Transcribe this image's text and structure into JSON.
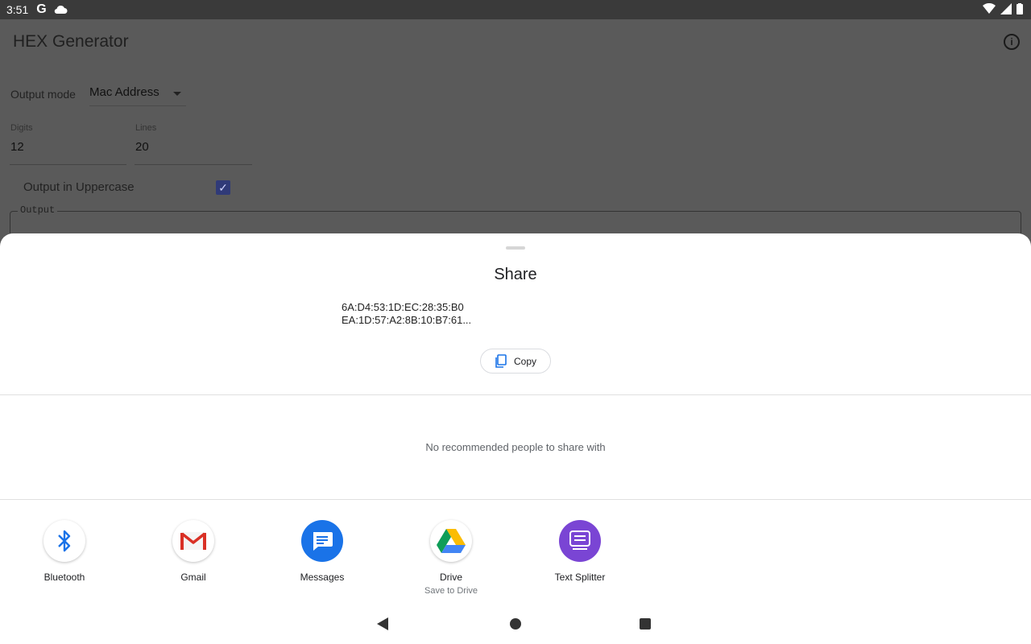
{
  "status": {
    "time": "3:51",
    "google_glyph": "G"
  },
  "app": {
    "title": "HEX Generator",
    "output_mode_label": "Output mode",
    "output_mode_value": "Mac Address",
    "digits_label": "Digits",
    "digits_value": "12",
    "lines_label": "Lines",
    "lines_value": "20",
    "uppercase_label": "Output in Uppercase",
    "output_label": "Output"
  },
  "share": {
    "title": "Share",
    "preview_line1": "6A:D4:53:1D:EC:28:35:B0",
    "preview_line2": "EA:1D:57:A2:8B:10:B7:61...",
    "copy_label": "Copy",
    "no_people": "No recommended people to share with",
    "apps": [
      {
        "name": "Bluetooth",
        "sub": ""
      },
      {
        "name": "Gmail",
        "sub": ""
      },
      {
        "name": "Messages",
        "sub": ""
      },
      {
        "name": "Drive",
        "sub": "Save to Drive"
      },
      {
        "name": "Text Splitter",
        "sub": ""
      }
    ]
  },
  "colors": {
    "messages_blue": "#1a73e8",
    "splitter_purple": "#7a45d4",
    "bluetooth_blue": "#1a73e8",
    "checkbox": "#303a78"
  }
}
